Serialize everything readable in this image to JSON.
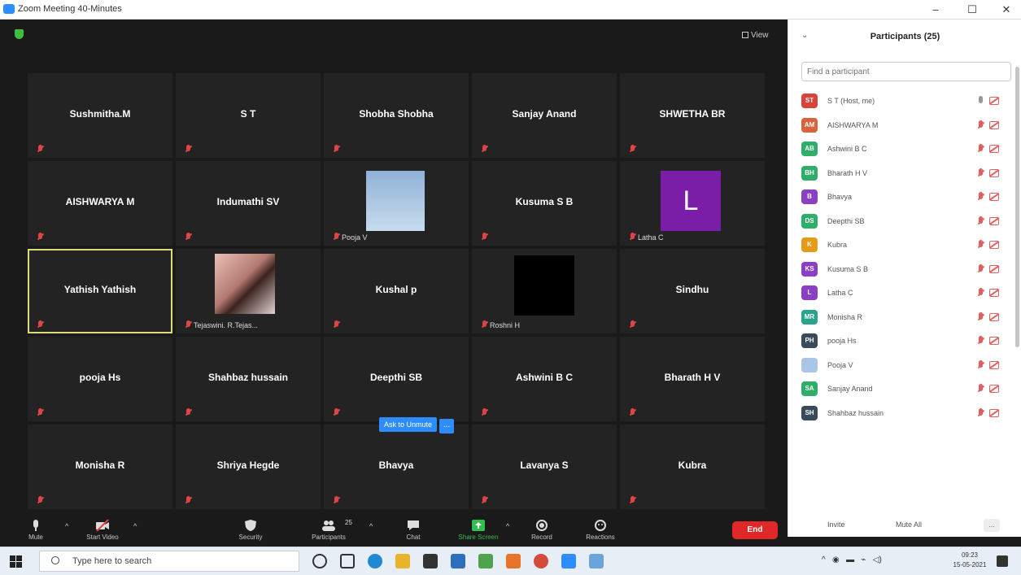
{
  "window": {
    "title": "Zoom Meeting 40-Minutes",
    "minimize": "–",
    "maximize": "☐",
    "close": "✕"
  },
  "meeting": {
    "view_label": "View",
    "ask_to_unmute": "Ask to Unmute",
    "ask_more": "...",
    "tiles": [
      {
        "name": "Sushmitha.M"
      },
      {
        "name": "S T"
      },
      {
        "name": "Shobha Shobha"
      },
      {
        "name": "Sanjay Anand"
      },
      {
        "name": "SHWETHA BR"
      },
      {
        "name": "AISHWARYA M"
      },
      {
        "name": "Indumathi SV"
      },
      {
        "name": "",
        "label": "Pooja V",
        "video": "sky"
      },
      {
        "name": "Kusuma S B"
      },
      {
        "name": "",
        "label": "Latha C",
        "video": "avatar-L",
        "avatar_letter": "L"
      },
      {
        "name": "Yathish Yathish",
        "active": true
      },
      {
        "name": "",
        "label": "Tejaswini. R.Tejas...",
        "video": "photo"
      },
      {
        "name": "Kushal p"
      },
      {
        "name": "",
        "label": "Roshni H",
        "video": "black"
      },
      {
        "name": "Sindhu"
      },
      {
        "name": "pooja Hs"
      },
      {
        "name": "Shahbaz hussain"
      },
      {
        "name": "Deepthi SB"
      },
      {
        "name": "Ashwini B C"
      },
      {
        "name": "Bharath H V"
      },
      {
        "name": "Monisha R"
      },
      {
        "name": "Shriya Hegde"
      },
      {
        "name": "Bhavya"
      },
      {
        "name": "Lavanya S"
      },
      {
        "name": "Kubra"
      }
    ]
  },
  "toolbar": {
    "mute": "Mute",
    "start_video": "Start Video",
    "security": "Security",
    "participants": "Participants",
    "participants_count": "25",
    "chat": "Chat",
    "share_screen": "Share Screen",
    "record": "Record",
    "reactions": "Reactions",
    "end": "End"
  },
  "participants_panel": {
    "title": "Participants (25)",
    "search_placeholder": "Find a participant",
    "invite": "Invite",
    "mute_all": "Mute All",
    "more": "...",
    "list": [
      {
        "initials": "ST",
        "name": "S T (Host, me)",
        "color": "#d9443a",
        "muted": false
      },
      {
        "initials": "AM",
        "name": "AISHWARYA M",
        "color": "#d9643a",
        "muted": true
      },
      {
        "initials": "AB",
        "name": "Ashwini B C",
        "color": "#2fae6a",
        "muted": true
      },
      {
        "initials": "BH",
        "name": "Bharath H V",
        "color": "#2fae6a",
        "muted": true
      },
      {
        "initials": "B",
        "name": "Bhavya",
        "color": "#8b3fc4",
        "muted": true
      },
      {
        "initials": "DS",
        "name": "Deepthi SB",
        "color": "#2fae6a",
        "muted": true
      },
      {
        "initials": "K",
        "name": "Kubra",
        "color": "#e59a1a",
        "muted": true
      },
      {
        "initials": "KS",
        "name": "Kusuma S B",
        "color": "#8b3fc4",
        "muted": true
      },
      {
        "initials": "L",
        "name": "Latha C",
        "color": "#8b3fc4",
        "muted": true
      },
      {
        "initials": "MR",
        "name": "Monisha R",
        "color": "#2aa58d",
        "muted": true
      },
      {
        "initials": "PH",
        "name": "pooja Hs",
        "color": "#3a4a5a",
        "muted": true
      },
      {
        "initials": "",
        "name": "Pooja V",
        "color": "#a8c4e6",
        "muted": true
      },
      {
        "initials": "SA",
        "name": "Sanjay Anand",
        "color": "#2fae6a",
        "muted": true
      },
      {
        "initials": "SH",
        "name": "Shahbaz hussain",
        "color": "#3a4a5a",
        "muted": true
      }
    ]
  },
  "taskbar": {
    "search_placeholder": "Type here to search",
    "time": "09:23",
    "date": "15-05-2021"
  }
}
